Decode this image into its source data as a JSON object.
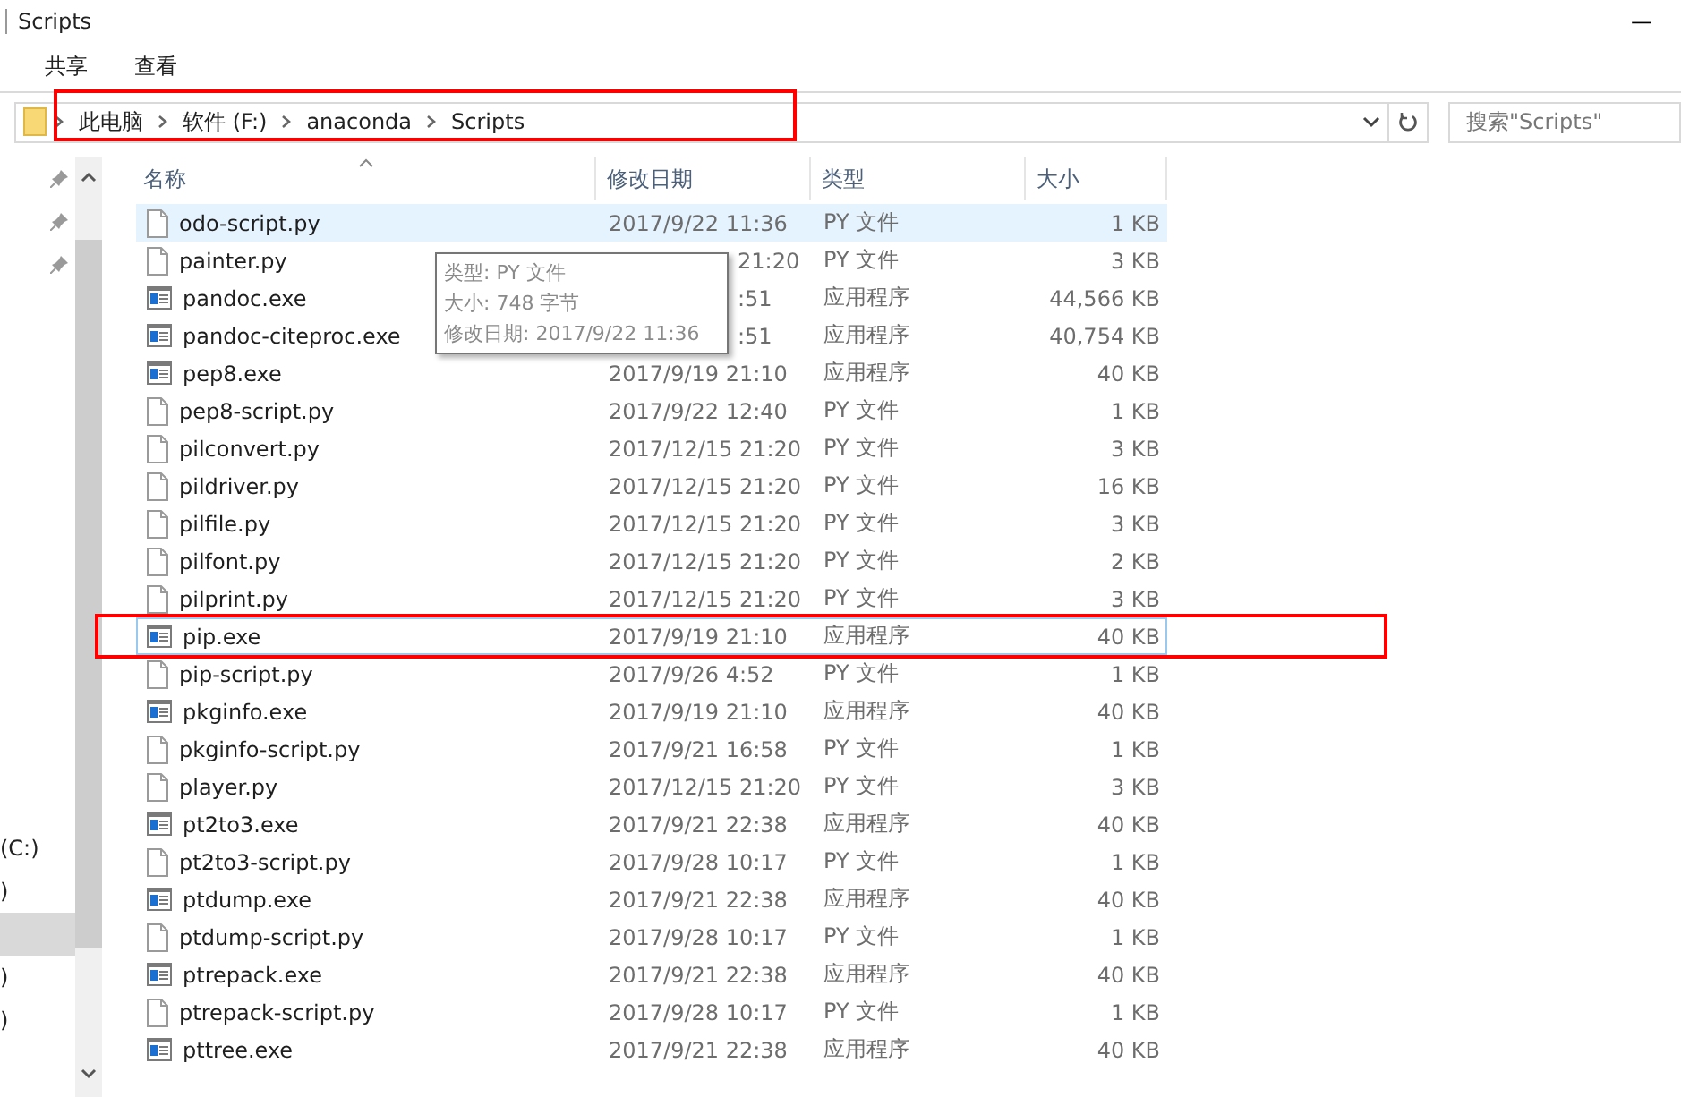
{
  "window": {
    "title": "Scripts",
    "minimize": "—"
  },
  "ribbon": {
    "tabs": [
      {
        "label": "共享"
      },
      {
        "label": "查看"
      }
    ]
  },
  "address_bar": {
    "segments": [
      "此电脑",
      "软件 (F:)",
      "anaconda",
      "Scripts"
    ],
    "highlighted": true
  },
  "search": {
    "placeholder": "搜索\"Scripts\""
  },
  "nav_pane": {
    "pinned": [
      {
        "pinned": true
      },
      {
        "pinned": true
      },
      {
        "pinned": true
      }
    ],
    "items": [
      {
        "label": "(C:)",
        "selected": false
      },
      {
        "label": ")",
        "selected": false
      },
      {
        "selected": true
      },
      {
        "label": ")",
        "selected": false
      },
      {
        "label": ")",
        "selected": false
      }
    ]
  },
  "table": {
    "columns": [
      "名称",
      "修改日期",
      "类型",
      "大小"
    ],
    "rows": [
      {
        "name": "odo-script.py",
        "date": "2017/9/22 11:36",
        "type": "PY 文件",
        "size": "1 KB",
        "kind": "py",
        "hovered": true,
        "focused": false
      },
      {
        "name": "painter.py",
        "date": "21:20",
        "date_covered": true,
        "type": "PY 文件",
        "size": "3 KB",
        "kind": "py",
        "hovered": false,
        "focused": false
      },
      {
        "name": "pandoc.exe",
        "date": ":51",
        "date_covered": true,
        "type": "应用程序",
        "size": "44,566 KB",
        "kind": "exe",
        "hovered": false,
        "focused": false
      },
      {
        "name": "pandoc-citeproc.exe",
        "date": ":51",
        "date_covered": true,
        "type": "应用程序",
        "size": "40,754 KB",
        "kind": "exe",
        "hovered": false,
        "focused": false
      },
      {
        "name": "pep8.exe",
        "date": "2017/9/19 21:10",
        "type": "应用程序",
        "size": "40 KB",
        "kind": "exe",
        "hovered": false,
        "focused": false
      },
      {
        "name": "pep8-script.py",
        "date": "2017/9/22 12:40",
        "type": "PY 文件",
        "size": "1 KB",
        "kind": "py",
        "hovered": false,
        "focused": false
      },
      {
        "name": "pilconvert.py",
        "date": "2017/12/15 21:20",
        "type": "PY 文件",
        "size": "3 KB",
        "kind": "py",
        "hovered": false,
        "focused": false
      },
      {
        "name": "pildriver.py",
        "date": "2017/12/15 21:20",
        "type": "PY 文件",
        "size": "16 KB",
        "kind": "py",
        "hovered": false,
        "focused": false
      },
      {
        "name": "pilfile.py",
        "date": "2017/12/15 21:20",
        "type": "PY 文件",
        "size": "3 KB",
        "kind": "py",
        "hovered": false,
        "focused": false
      },
      {
        "name": "pilfont.py",
        "date": "2017/12/15 21:20",
        "type": "PY 文件",
        "size": "2 KB",
        "kind": "py",
        "hovered": false,
        "focused": false
      },
      {
        "name": "pilprint.py",
        "date": "2017/12/15 21:20",
        "type": "PY 文件",
        "size": "3 KB",
        "kind": "py",
        "hovered": false,
        "focused": false
      },
      {
        "name": "pip.exe",
        "date": "2017/9/19 21:10",
        "type": "应用程序",
        "size": "40 KB",
        "kind": "exe",
        "hovered": false,
        "focused": true,
        "highlighted": true
      },
      {
        "name": "pip-script.py",
        "date": "2017/9/26 4:52",
        "type": "PY 文件",
        "size": "1 KB",
        "kind": "py",
        "hovered": false,
        "focused": false
      },
      {
        "name": "pkginfo.exe",
        "date": "2017/9/19 21:10",
        "type": "应用程序",
        "size": "40 KB",
        "kind": "exe",
        "hovered": false,
        "focused": false
      },
      {
        "name": "pkginfo-script.py",
        "date": "2017/9/21 16:58",
        "type": "PY 文件",
        "size": "1 KB",
        "kind": "py",
        "hovered": false,
        "focused": false
      },
      {
        "name": "player.py",
        "date": "2017/12/15 21:20",
        "type": "PY 文件",
        "size": "3 KB",
        "kind": "py",
        "hovered": false,
        "focused": false
      },
      {
        "name": "pt2to3.exe",
        "date": "2017/9/21 22:38",
        "type": "应用程序",
        "size": "40 KB",
        "kind": "exe",
        "hovered": false,
        "focused": false
      },
      {
        "name": "pt2to3-script.py",
        "date": "2017/9/28 10:17",
        "type": "PY 文件",
        "size": "1 KB",
        "kind": "py",
        "hovered": false,
        "focused": false
      },
      {
        "name": "ptdump.exe",
        "date": "2017/9/21 22:38",
        "type": "应用程序",
        "size": "40 KB",
        "kind": "exe",
        "hovered": false,
        "focused": false
      },
      {
        "name": "ptdump-script.py",
        "date": "2017/9/28 10:17",
        "type": "PY 文件",
        "size": "1 KB",
        "kind": "py",
        "hovered": false,
        "focused": false
      },
      {
        "name": "ptrepack.exe",
        "date": "2017/9/21 22:38",
        "type": "应用程序",
        "size": "40 KB",
        "kind": "exe",
        "hovered": false,
        "focused": false
      },
      {
        "name": "ptrepack-script.py",
        "date": "2017/9/28 10:17",
        "type": "PY 文件",
        "size": "1 KB",
        "kind": "py",
        "hovered": false,
        "focused": false
      },
      {
        "name": "pttree.exe",
        "date": "2017/9/21 22:38",
        "type": "应用程序",
        "size": "40 KB",
        "kind": "exe",
        "hovered": false,
        "focused": false
      }
    ]
  },
  "tooltip": {
    "lines": [
      "类型: PY 文件",
      "大小: 748 字节",
      "修改日期: 2017/9/22 11:36"
    ]
  }
}
